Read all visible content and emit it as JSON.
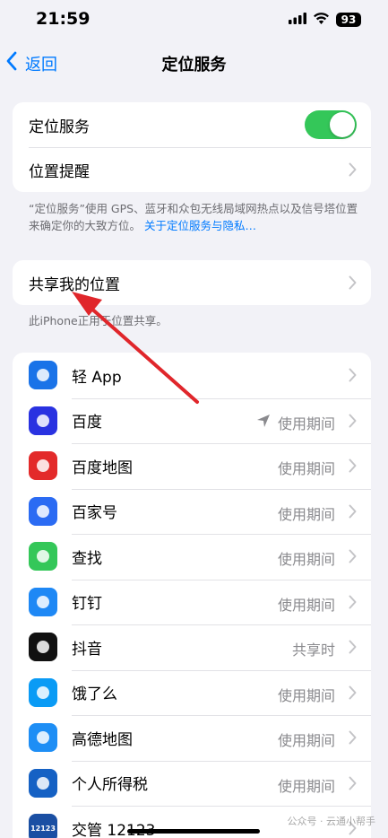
{
  "status_bar": {
    "time": "21:59",
    "battery": "93"
  },
  "nav": {
    "back_label": "返回",
    "title": "定位服务"
  },
  "location_card": {
    "toggle_label": "定位服务",
    "toggle_on": true,
    "alerts_label": "位置提醒"
  },
  "location_footnote": {
    "text": "“定位服务”使用 GPS、蓝牙和众包无线局域网热点以及信号塔位置来确定你的大致方位。",
    "link": "关于定位服务与隐私…"
  },
  "share_card": {
    "label": "共享我的位置"
  },
  "share_footnote": "此iPhone正用于位置共享。",
  "apps": [
    {
      "name": "轻 App",
      "status": "",
      "icon": "light-app-icon",
      "color": "#1a73e8"
    },
    {
      "name": "百度",
      "status": "使用期间",
      "location_arrow": true,
      "icon": "baidu-icon",
      "color": "#2932e1"
    },
    {
      "name": "百度地图",
      "status": "使用期间",
      "icon": "baidu-map-icon",
      "color": "#e32a2a"
    },
    {
      "name": "百家号",
      "status": "使用期间",
      "icon": "baijiahao-icon",
      "color": "#2b6bf3"
    },
    {
      "name": "查找",
      "status": "使用期间",
      "icon": "find-my-icon",
      "color": "#34c759"
    },
    {
      "name": "钉钉",
      "status": "使用期间",
      "icon": "dingtalk-icon",
      "color": "#1e88f5"
    },
    {
      "name": "抖音",
      "status": "共享时",
      "icon": "douyin-icon",
      "color": "#111111"
    },
    {
      "name": "饿了么",
      "status": "使用期间",
      "icon": "eleme-icon",
      "color": "#0a9bf5"
    },
    {
      "name": "高德地图",
      "status": "使用期间",
      "icon": "amap-icon",
      "color": "#1e8ef5"
    },
    {
      "name": "个人所得税",
      "status": "使用期间",
      "icon": "tax-icon",
      "color": "#1561c4"
    },
    {
      "name": "交管 12123",
      "status": "",
      "icon": "traffic-12123-icon",
      "color": "#1a4fa3",
      "icon_text": "12123"
    }
  ],
  "watermark": "公众号 · 云通小帮手"
}
